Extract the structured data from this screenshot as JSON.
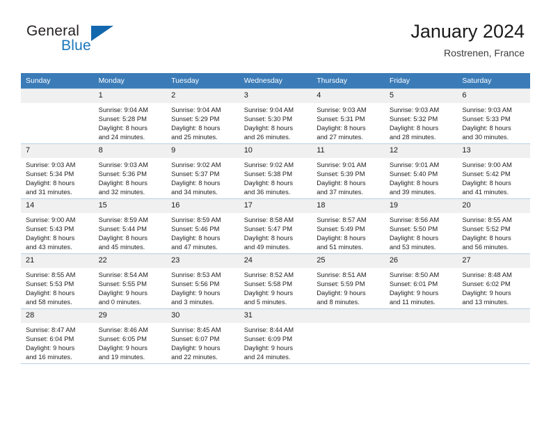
{
  "brand": {
    "name_top": "General",
    "name_bottom": "Blue",
    "flag_icon": "blue-triangle-flag-icon",
    "accent_color": "#1368ad",
    "text_color": "#231f20"
  },
  "header": {
    "title": "January 2024",
    "subtitle": "Rostrenen, France"
  },
  "calendar": {
    "header_bg": "#3b7cb8",
    "header_text_color": "#ffffff",
    "daynum_bg": "#f0f0f0",
    "row_border_color": "#b9cfe3",
    "weekdays": [
      "Sunday",
      "Monday",
      "Tuesday",
      "Wednesday",
      "Thursday",
      "Friday",
      "Saturday"
    ],
    "weeks": [
      [
        {
          "day": "",
          "lines": []
        },
        {
          "day": "1",
          "lines": [
            "Sunrise: 9:04 AM",
            "Sunset: 5:28 PM",
            "Daylight: 8 hours",
            "and 24 minutes."
          ]
        },
        {
          "day": "2",
          "lines": [
            "Sunrise: 9:04 AM",
            "Sunset: 5:29 PM",
            "Daylight: 8 hours",
            "and 25 minutes."
          ]
        },
        {
          "day": "3",
          "lines": [
            "Sunrise: 9:04 AM",
            "Sunset: 5:30 PM",
            "Daylight: 8 hours",
            "and 26 minutes."
          ]
        },
        {
          "day": "4",
          "lines": [
            "Sunrise: 9:03 AM",
            "Sunset: 5:31 PM",
            "Daylight: 8 hours",
            "and 27 minutes."
          ]
        },
        {
          "day": "5",
          "lines": [
            "Sunrise: 9:03 AM",
            "Sunset: 5:32 PM",
            "Daylight: 8 hours",
            "and 28 minutes."
          ]
        },
        {
          "day": "6",
          "lines": [
            "Sunrise: 9:03 AM",
            "Sunset: 5:33 PM",
            "Daylight: 8 hours",
            "and 30 minutes."
          ]
        }
      ],
      [
        {
          "day": "7",
          "lines": [
            "Sunrise: 9:03 AM",
            "Sunset: 5:34 PM",
            "Daylight: 8 hours",
            "and 31 minutes."
          ]
        },
        {
          "day": "8",
          "lines": [
            "Sunrise: 9:03 AM",
            "Sunset: 5:36 PM",
            "Daylight: 8 hours",
            "and 32 minutes."
          ]
        },
        {
          "day": "9",
          "lines": [
            "Sunrise: 9:02 AM",
            "Sunset: 5:37 PM",
            "Daylight: 8 hours",
            "and 34 minutes."
          ]
        },
        {
          "day": "10",
          "lines": [
            "Sunrise: 9:02 AM",
            "Sunset: 5:38 PM",
            "Daylight: 8 hours",
            "and 36 minutes."
          ]
        },
        {
          "day": "11",
          "lines": [
            "Sunrise: 9:01 AM",
            "Sunset: 5:39 PM",
            "Daylight: 8 hours",
            "and 37 minutes."
          ]
        },
        {
          "day": "12",
          "lines": [
            "Sunrise: 9:01 AM",
            "Sunset: 5:40 PM",
            "Daylight: 8 hours",
            "and 39 minutes."
          ]
        },
        {
          "day": "13",
          "lines": [
            "Sunrise: 9:00 AM",
            "Sunset: 5:42 PM",
            "Daylight: 8 hours",
            "and 41 minutes."
          ]
        }
      ],
      [
        {
          "day": "14",
          "lines": [
            "Sunrise: 9:00 AM",
            "Sunset: 5:43 PM",
            "Daylight: 8 hours",
            "and 43 minutes."
          ]
        },
        {
          "day": "15",
          "lines": [
            "Sunrise: 8:59 AM",
            "Sunset: 5:44 PM",
            "Daylight: 8 hours",
            "and 45 minutes."
          ]
        },
        {
          "day": "16",
          "lines": [
            "Sunrise: 8:59 AM",
            "Sunset: 5:46 PM",
            "Daylight: 8 hours",
            "and 47 minutes."
          ]
        },
        {
          "day": "17",
          "lines": [
            "Sunrise: 8:58 AM",
            "Sunset: 5:47 PM",
            "Daylight: 8 hours",
            "and 49 minutes."
          ]
        },
        {
          "day": "18",
          "lines": [
            "Sunrise: 8:57 AM",
            "Sunset: 5:49 PM",
            "Daylight: 8 hours",
            "and 51 minutes."
          ]
        },
        {
          "day": "19",
          "lines": [
            "Sunrise: 8:56 AM",
            "Sunset: 5:50 PM",
            "Daylight: 8 hours",
            "and 53 minutes."
          ]
        },
        {
          "day": "20",
          "lines": [
            "Sunrise: 8:55 AM",
            "Sunset: 5:52 PM",
            "Daylight: 8 hours",
            "and 56 minutes."
          ]
        }
      ],
      [
        {
          "day": "21",
          "lines": [
            "Sunrise: 8:55 AM",
            "Sunset: 5:53 PM",
            "Daylight: 8 hours",
            "and 58 minutes."
          ]
        },
        {
          "day": "22",
          "lines": [
            "Sunrise: 8:54 AM",
            "Sunset: 5:55 PM",
            "Daylight: 9 hours",
            "and 0 minutes."
          ]
        },
        {
          "day": "23",
          "lines": [
            "Sunrise: 8:53 AM",
            "Sunset: 5:56 PM",
            "Daylight: 9 hours",
            "and 3 minutes."
          ]
        },
        {
          "day": "24",
          "lines": [
            "Sunrise: 8:52 AM",
            "Sunset: 5:58 PM",
            "Daylight: 9 hours",
            "and 5 minutes."
          ]
        },
        {
          "day": "25",
          "lines": [
            "Sunrise: 8:51 AM",
            "Sunset: 5:59 PM",
            "Daylight: 9 hours",
            "and 8 minutes."
          ]
        },
        {
          "day": "26",
          "lines": [
            "Sunrise: 8:50 AM",
            "Sunset: 6:01 PM",
            "Daylight: 9 hours",
            "and 11 minutes."
          ]
        },
        {
          "day": "27",
          "lines": [
            "Sunrise: 8:48 AM",
            "Sunset: 6:02 PM",
            "Daylight: 9 hours",
            "and 13 minutes."
          ]
        }
      ],
      [
        {
          "day": "28",
          "lines": [
            "Sunrise: 8:47 AM",
            "Sunset: 6:04 PM",
            "Daylight: 9 hours",
            "and 16 minutes."
          ]
        },
        {
          "day": "29",
          "lines": [
            "Sunrise: 8:46 AM",
            "Sunset: 6:05 PM",
            "Daylight: 9 hours",
            "and 19 minutes."
          ]
        },
        {
          "day": "30",
          "lines": [
            "Sunrise: 8:45 AM",
            "Sunset: 6:07 PM",
            "Daylight: 9 hours",
            "and 22 minutes."
          ]
        },
        {
          "day": "31",
          "lines": [
            "Sunrise: 8:44 AM",
            "Sunset: 6:09 PM",
            "Daylight: 9 hours",
            "and 24 minutes."
          ]
        },
        {
          "day": "",
          "lines": []
        },
        {
          "day": "",
          "lines": []
        },
        {
          "day": "",
          "lines": []
        }
      ]
    ]
  }
}
